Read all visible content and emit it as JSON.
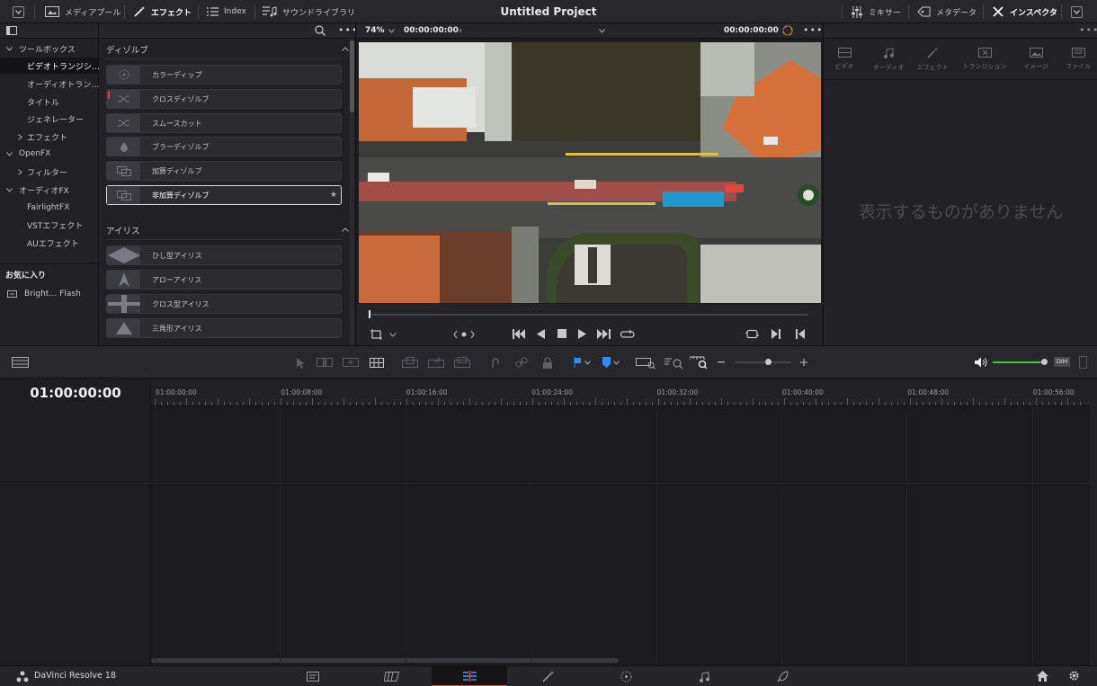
{
  "colors": {
    "accent_red": "#e0443a",
    "accent_blue": "#2a8cff",
    "volume_green": "#3fc43f",
    "panel_bg": "#1c1c1f"
  },
  "topbar": {
    "media_pool": "メディアプール",
    "effects": "エフェクト",
    "index": "Index",
    "sound_library": "サウンドライブラリ",
    "project_title": "Untitled Project",
    "mixer": "ミキサー",
    "metadata": "メタデータ",
    "inspector": "インスペクタ"
  },
  "sidebar": {
    "items": [
      {
        "label": "ツールボックス",
        "expanded": true
      },
      {
        "label": "ビデオトランジシ…",
        "selected": true
      },
      {
        "label": "オーディオトラン…"
      },
      {
        "label": "タイトル"
      },
      {
        "label": "ジェネレーター"
      },
      {
        "label": "エフェクト",
        "expanded": false
      },
      {
        "label": "OpenFX",
        "expanded": true
      },
      {
        "label": "フィルター",
        "expanded": false
      },
      {
        "label": "オーディオFX",
        "expanded": true
      },
      {
        "label": "FairlightFX"
      },
      {
        "label": "VSTエフェクト"
      },
      {
        "label": "AUエフェクト"
      }
    ],
    "favorites_heading": "お気に入り",
    "favorites": [
      {
        "label": "Bright… Flash"
      }
    ]
  },
  "effects_panel": {
    "dissolve_heading": "ディゾルブ",
    "dissolve_items": [
      {
        "label": "カラーディップ",
        "icon": "dot-circle-icon"
      },
      {
        "label": "クロスディゾルブ",
        "icon": "shuffle-icon"
      },
      {
        "label": "スムースカット",
        "icon": "shuffle-icon"
      },
      {
        "label": "ブラーディゾルブ",
        "icon": "drop-icon"
      },
      {
        "label": "加算ディゾルブ",
        "icon": "overlap-icon"
      },
      {
        "label": "非加算ディゾルブ",
        "icon": "overlap-icon",
        "selected": true
      }
    ],
    "iris_heading": "アイリス",
    "iris_items": [
      {
        "label": "ひし型アイリス",
        "icon": "diamond-icon"
      },
      {
        "label": "アローアイリス",
        "icon": "arrow-icon"
      },
      {
        "label": "クロス型アイリス",
        "icon": "cross-icon"
      },
      {
        "label": "三角形アイリス",
        "icon": "triangle-icon"
      }
    ]
  },
  "viewer": {
    "zoom": "74%",
    "source_timecode": "00:00:00:00",
    "record_timecode": "00:00:00:00"
  },
  "inspector": {
    "tabs": [
      "ビデオ",
      "オーディオ",
      "エフェクト",
      "トランジション",
      "イメージ",
      "ファイル"
    ],
    "empty_message": "表示するものがありません"
  },
  "timeline": {
    "timecode": "01:00:00:00",
    "dim_label": "DIM",
    "volume_level": 0.95,
    "ruler_labels": [
      "01:00:00:00",
      "01:00:08:00",
      "01:00:16:00",
      "01:00:24:00",
      "01:00:32:00",
      "01:00:40:00",
      "01:00:48:00",
      "01:00:56:00"
    ]
  },
  "bottombar": {
    "app_name": "DaVinci Resolve 18",
    "pages": [
      "media-page",
      "cut-page",
      "edit-page",
      "fusion-page",
      "color-page",
      "fairlight-page",
      "deliver-page"
    ],
    "active_page": "edit-page"
  }
}
